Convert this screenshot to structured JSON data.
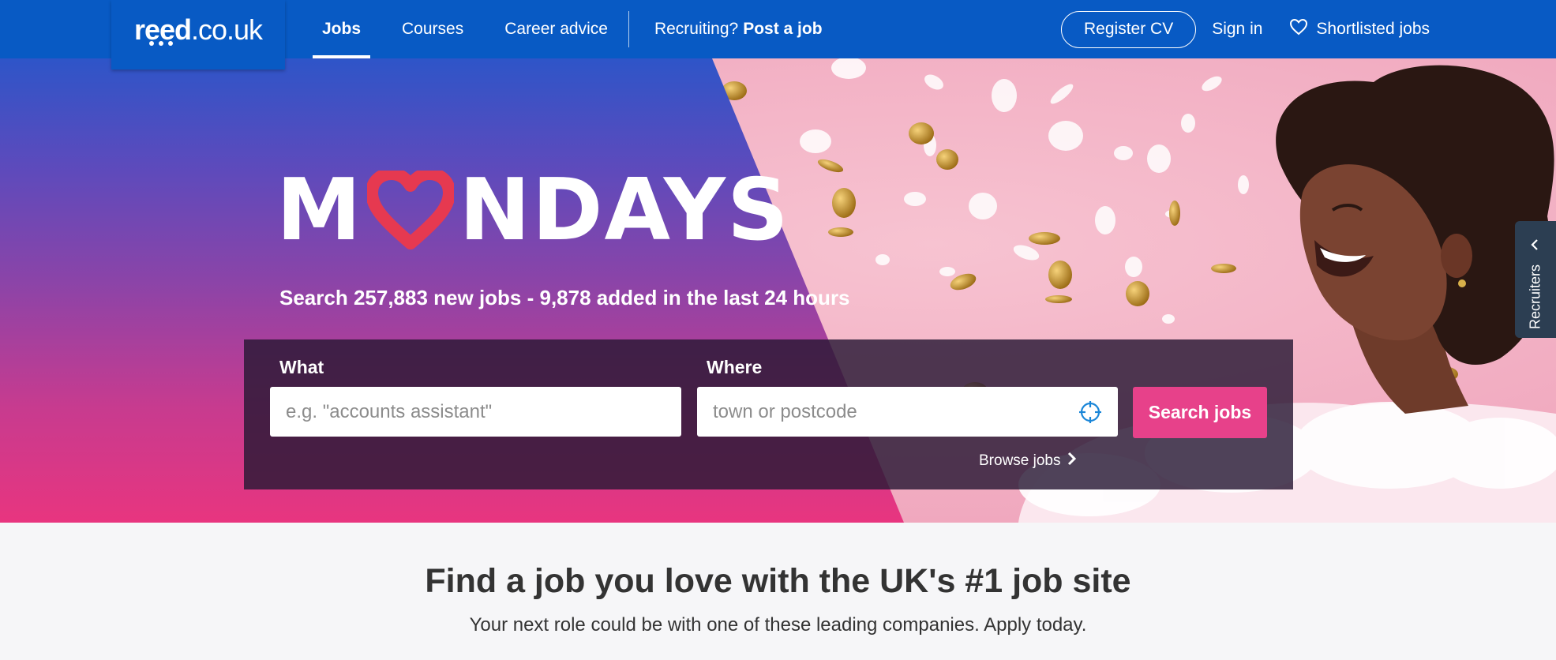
{
  "brand": {
    "logo_bold": "reed",
    "logo_rest": ".co.uk"
  },
  "nav": {
    "jobs": "Jobs",
    "courses": "Courses",
    "career_advice": "Career advice",
    "recruiting_prefix": "Recruiting?",
    "post_job": "Post a job"
  },
  "account": {
    "register_cv": "Register CV",
    "sign_in": "Sign in",
    "shortlisted": "Shortlisted jobs"
  },
  "hero": {
    "headline_start": "M",
    "headline_end": "NDAYS",
    "subhead": "Search 257,883 new jobs - 9,878 added in the last 24 hours"
  },
  "search": {
    "what_label": "What",
    "what_placeholder": "e.g. \"accounts assistant\"",
    "where_label": "Where",
    "where_placeholder": "town or postcode",
    "button": "Search jobs",
    "browse": "Browse jobs"
  },
  "side_tab": {
    "label": "Recruiters"
  },
  "promo": {
    "tagline_plain": "Find a job you love with the ",
    "tagline_bold": "UK's #1 job site",
    "subtext": "Your next role could be with one of these leading companies. Apply today."
  },
  "colors": {
    "header_blue": "#085ac4",
    "accent_pink": "#e7418a",
    "heart_red": "#e63950",
    "panel": "#281834"
  },
  "icons": [
    "heart-outline-icon",
    "location-target-icon",
    "chevron-right-icon",
    "chevron-left-icon"
  ]
}
